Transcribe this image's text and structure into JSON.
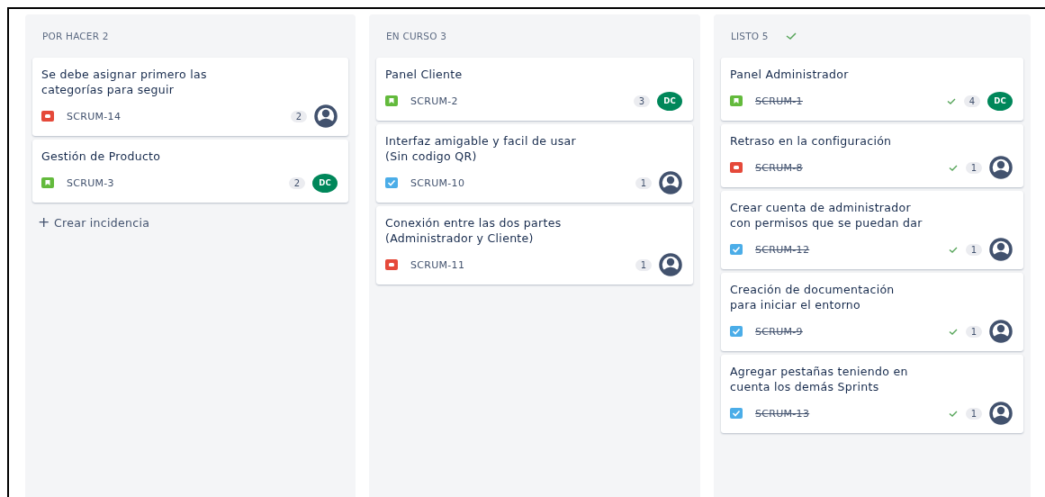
{
  "columns": [
    {
      "title": "POR HACER 2",
      "done_mark": false,
      "create_label": "Crear incidencia",
      "create_icon": "+",
      "cards": [
        {
          "title": "Se debe asignar primero las\ncategorías para seguir",
          "kind": "bug",
          "key": "SCRUM-14",
          "done": false,
          "points": "2",
          "assignee": {
            "kind": "unassigned"
          }
        },
        {
          "title": "Gestión de Producto",
          "kind": "story",
          "key": "SCRUM-3",
          "done": false,
          "points": "2",
          "assignee": {
            "kind": "initials",
            "initials": "DC"
          }
        }
      ]
    },
    {
      "title": "EN CURSO 3",
      "done_mark": false,
      "cards": [
        {
          "title": "Panel Cliente",
          "kind": "story",
          "key": "SCRUM-2",
          "done": false,
          "points": "3",
          "assignee": {
            "kind": "initials",
            "initials": "DC"
          }
        },
        {
          "title": "Interfaz amigable y facil de usar\n(Sin codigo QR)",
          "kind": "task",
          "key": "SCRUM-10",
          "done": false,
          "points": "1",
          "assignee": {
            "kind": "unassigned"
          }
        },
        {
          "title": "Conexión entre las dos partes\n(Administrador y Cliente)",
          "kind": "bug",
          "key": "SCRUM-11",
          "done": false,
          "points": "1",
          "assignee": {
            "kind": "unassigned"
          }
        }
      ]
    },
    {
      "title": "LISTO 5",
      "done_mark": true,
      "cards": [
        {
          "title": "Panel Administrador",
          "kind": "story",
          "key": "SCRUM-1",
          "done": true,
          "points": "4",
          "assignee": {
            "kind": "initials",
            "initials": "DC"
          }
        },
        {
          "title": "Retraso en la configuración",
          "kind": "bug",
          "key": "SCRUM-8",
          "done": true,
          "points": "1",
          "assignee": {
            "kind": "unassigned"
          }
        },
        {
          "title": "Crear cuenta de administrador\ncon permisos que se puedan dar",
          "kind": "task",
          "key": "SCRUM-12",
          "done": true,
          "points": "1",
          "assignee": {
            "kind": "unassigned"
          }
        },
        {
          "title": "Creación de documentación\npara iniciar el entorno",
          "kind": "task",
          "key": "SCRUM-9",
          "done": true,
          "points": "1",
          "assignee": {
            "kind": "unassigned"
          }
        },
        {
          "title": "Agregar pestañas teniendo en\ncuenta los demás Sprints",
          "kind": "task",
          "key": "SCRUM-13",
          "done": true,
          "points": "1",
          "assignee": {
            "kind": "unassigned"
          }
        }
      ]
    }
  ]
}
